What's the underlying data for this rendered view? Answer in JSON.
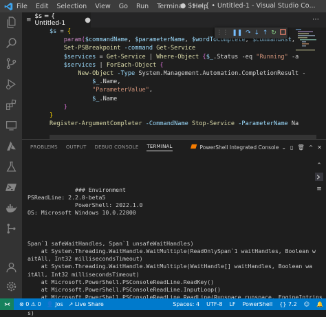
{
  "titlebar": {
    "menu": [
      "File",
      "Edit",
      "Selection",
      "View",
      "Go",
      "Run",
      "Terminal",
      "Help"
    ],
    "title": "● $s = { • Untitled-1 - Visual Studio Co..."
  },
  "tab": {
    "label": "$s = { Untitled-1"
  },
  "code_lines": [
    [
      [
        "$s",
        "var"
      ],
      [
        " = ",
        "op"
      ],
      [
        "{",
        "br1"
      ]
    ],
    [
      [
        "    ",
        "op"
      ],
      [
        "param",
        "kw"
      ],
      [
        "(",
        "br2"
      ],
      [
        "$commandName",
        "var"
      ],
      [
        ", ",
        "op"
      ],
      [
        "$parameterName",
        "var"
      ],
      [
        ", ",
        "op"
      ],
      [
        "$wordToComplete",
        "var"
      ],
      [
        ", ",
        "op"
      ],
      [
        "$commandAst",
        "var"
      ],
      [
        ", ",
        "op"
      ]
    ],
    [
      [
        "    ",
        "op"
      ],
      [
        "Set-PSBreakpoint",
        "cmd"
      ],
      [
        " -command ",
        "param"
      ],
      [
        "Get-Service",
        "cmd"
      ]
    ],
    [
      [
        "    ",
        "op"
      ],
      [
        "$services",
        "var"
      ],
      [
        " = ",
        "op"
      ],
      [
        "Get-Service",
        "cmd"
      ],
      [
        " | ",
        "op"
      ],
      [
        "Where-Object",
        "cmd"
      ],
      [
        " {",
        "br2"
      ],
      [
        "$_",
        "var"
      ],
      [
        ".Status ",
        "op"
      ],
      [
        "-eq ",
        "op"
      ],
      [
        "\"Running\"",
        "str"
      ],
      [
        " -a",
        "op"
      ]
    ],
    [
      [
        "    ",
        "op"
      ],
      [
        "$services",
        "var"
      ],
      [
        " | ",
        "op"
      ],
      [
        "ForEach-Object",
        "cmd"
      ],
      [
        " {",
        "br2"
      ]
    ],
    [
      [
        "        ",
        "op"
      ],
      [
        "New-Object",
        "cmd"
      ],
      [
        " -Type ",
        "param"
      ],
      [
        "System.Management.Automation.CompletionResult",
        "op"
      ],
      [
        " -",
        "op"
      ]
    ],
    [
      [
        "            ",
        "op"
      ],
      [
        "$_",
        "var"
      ],
      [
        ".Name,",
        "op"
      ]
    ],
    [
      [
        "            ",
        "op"
      ],
      [
        "\"ParameterValue\"",
        "str"
      ],
      [
        ",",
        "op"
      ]
    ],
    [
      [
        "            ",
        "op"
      ],
      [
        "$_",
        "var"
      ],
      [
        ".Name",
        "op"
      ]
    ],
    [
      [
        "    ",
        "op"
      ],
      [
        "}",
        "br2"
      ]
    ],
    [
      [
        "}",
        "br1"
      ]
    ],
    [
      [
        "Register-ArgumentCompleter",
        "cmd"
      ],
      [
        " -CommandName ",
        "param"
      ],
      [
        "Stop-Service",
        "cmd"
      ],
      [
        " -ParameterName ",
        "param"
      ],
      [
        "Na",
        "op"
      ]
    ]
  ],
  "panel": {
    "tabs": [
      "PROBLEMS",
      "OUTPUT",
      "DEBUG CONSOLE",
      "TERMINAL"
    ],
    "active_tab": "TERMINAL",
    "terminal_name": "PowerShell Integrated Console"
  },
  "terminal_lines": [
    "",
    "",
    "",
    "              ### Environment",
    "PSReadLine: 2.2.0-beta5",
    "              PowerShell: 2022.1.0",
    "OS: Microsoft Windows 10.0.22000",
    "",
    "",
    "",
    "Span`1 safeWaitHandles, Span`1 unsafeWaitHandles)",
    "    at System.Threading.WaitHandle.WaitMultiple(ReadOnlySpan`1 waitHandles, Boolean w",
    "aitAll, Int32 millisecondsTimeout)",
    "    at System.Threading.WaitHandle.WaitMultiple(WaitHandle[] waitHandles, Boolean wa",
    "itAll, Int32 millisecondsTimeout)",
    "    at Microsoft.PowerShell.PSConsoleReadLine.ReadKey()",
    "    at Microsoft.PowerShell.PSConsoleReadLine.InputLoop()",
    "    at Microsoft.PowerShell.PSConsoleReadLine.ReadLine(Runspace runspace, EngineIntrins",
    "ics engineIntrinsics, CancellationToken cancellationToken, Nullable`1 lastRunStatu",
    "s)"
  ],
  "statusbar": {
    "errors": "0",
    "warnings": "0",
    "user": "Jos",
    "live_share": "Live Share",
    "spaces": "Spaces: 4",
    "encoding": "UTF-8",
    "eol": "LF",
    "language": "PowerShell",
    "version": "7.2"
  },
  "colors": {
    "accent": "#007acc",
    "remote": "#16825d",
    "titlebar": "#3c3c3c",
    "activitybar": "#333333",
    "editor_bg": "#1e1e1e",
    "debug_continue": "#75beff",
    "debug_restart": "#89d185",
    "debug_stop": "#f48771",
    "powershell_icon": "#f57c00"
  },
  "icons": {
    "activity": [
      "explorer-icon",
      "search-icon",
      "source-control-icon",
      "run-debug-icon",
      "extensions-icon",
      "remote-explorer-icon",
      "azure-icon",
      "testing-icon",
      "powershell-icon",
      "docker-icon",
      "git-graph-icon"
    ],
    "bottom": [
      "account-icon",
      "settings-gear-icon"
    ]
  }
}
